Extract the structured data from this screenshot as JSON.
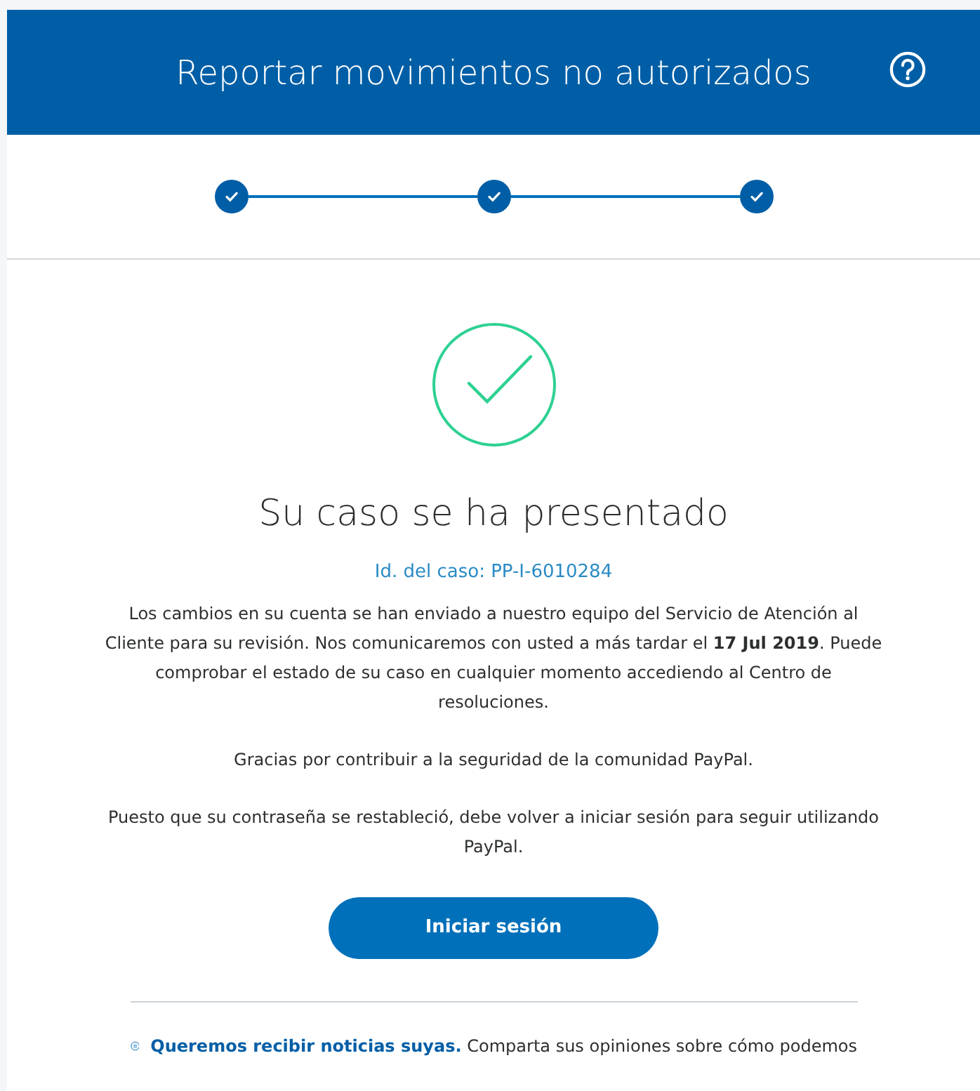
{
  "header": {
    "title": "Reportar movimientos no autorizados"
  },
  "steps": [
    {
      "completed": true
    },
    {
      "completed": true
    },
    {
      "completed": true
    }
  ],
  "result": {
    "title": "Su caso se ha presentado",
    "case_id": "Id. del caso: PP-I-6010284",
    "paragraphs": [
      "Los cambios en su cuenta se han enviado a nuestro equipo del Servicio de Atención al Cliente para su revisión. Nos comunicaremos con usted a más tardar el **17 Jul 2019**. Puede comprobar el estado de su caso en cualquier momento accediendo al Centro de resoluciones.",
      "Gracias por contribuir a la seguridad de la comunidad PayPal.",
      "Puesto que su contraseña se restableció, debe volver a iniciar sesión para seguir utilizando PayPal."
    ],
    "button": "Iniciar sesión"
  },
  "feedback": {
    "link": "Queremos recibir noticias suyas.",
    "text": "Comparta sus opiniones sobre cómo podemos"
  }
}
